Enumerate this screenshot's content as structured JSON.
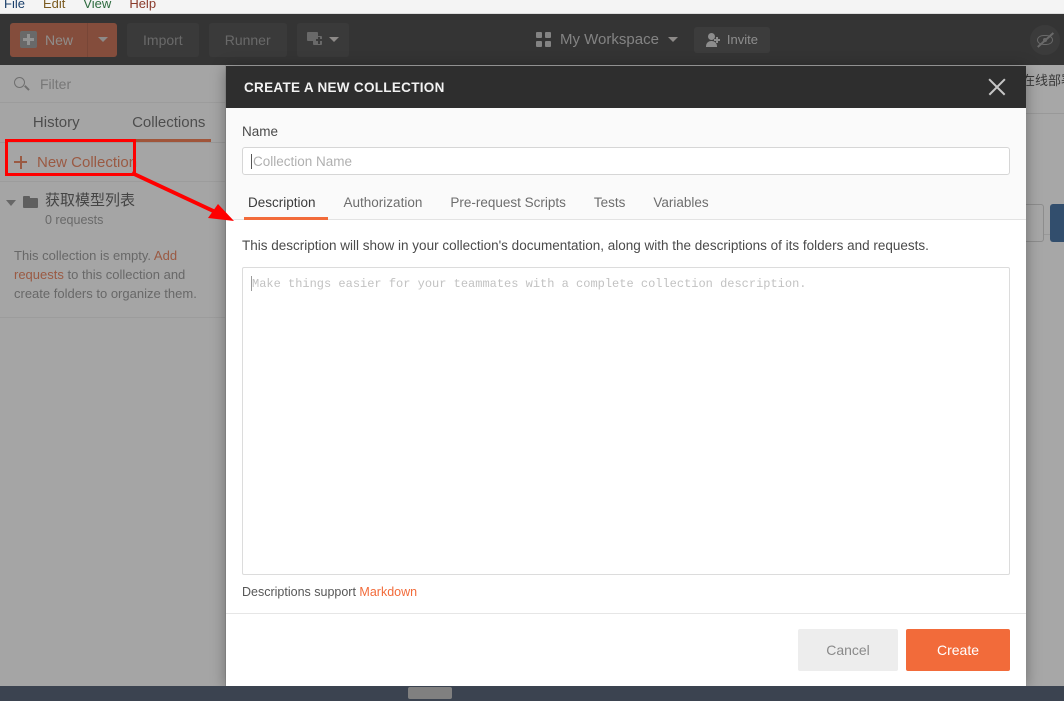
{
  "menubar": {
    "items": [
      "File",
      "Edit",
      "View",
      "Help"
    ]
  },
  "toolbar": {
    "new_label": "New",
    "new_icon": "plus-square-icon",
    "new_caret_icon": "caret-down-icon",
    "import_label": "Import",
    "runner_label": "Runner",
    "new_tab_icon": "new-tab-icon",
    "new_tab_caret_icon": "caret-down-icon"
  },
  "workspace": {
    "grid_icon": "grid-icon",
    "name": "My Workspace",
    "caret_icon": "caret-down-icon",
    "invite_label": "Invite",
    "invite_icon": "person-add-icon",
    "eye_slash_icon": "eye-slash-icon"
  },
  "sidebar": {
    "filter_placeholder": "Filter",
    "search_icon": "search-icon",
    "tabs": [
      {
        "label": "History",
        "active": false
      },
      {
        "label": "Collections",
        "active": true
      }
    ],
    "new_collection_label": "New Collection",
    "new_collection_icon": "plus-icon",
    "collection": {
      "expand_icon": "triangle-down-icon",
      "folder_icon": "folder-icon",
      "name": "获取模型列表",
      "requests": "0 requests"
    },
    "empty_message_prefix": "This collection is empty. ",
    "empty_message_link": "Add requests",
    "empty_message_suffix": " to this collection and create folders to organize them."
  },
  "right_panel": {
    "clipped_title": "在线部署"
  },
  "modal": {
    "title": "CREATE A NEW COLLECTION",
    "close_icon": "close-icon",
    "name_label": "Name",
    "name_value": "",
    "name_placeholder": "Collection Name",
    "tabs": [
      {
        "label": "Description",
        "active": true
      },
      {
        "label": "Authorization",
        "active": false
      },
      {
        "label": "Pre-request Scripts",
        "active": false
      },
      {
        "label": "Tests",
        "active": false
      },
      {
        "label": "Variables",
        "active": false
      }
    ],
    "description_help": "This description will show in your collection's documentation, along with the descriptions of its folders and requests.",
    "description_value": "",
    "description_placeholder": "Make things easier for your teammates with a complete collection description.",
    "markdown_note_prefix": "Descriptions support ",
    "markdown_link": "Markdown",
    "cancel_label": "Cancel",
    "create_label": "Create"
  },
  "annotations": {
    "highlight_target": "New Collection",
    "arrow_target": "Description tab",
    "color": "#ff0000"
  },
  "colors": {
    "accent_orange": "#f26b3a",
    "toolbar_dark": "#2f2f2f",
    "modal_header": "#2e2e2e",
    "blue_button": "#2b5d96",
    "status_bar": "#3b4350"
  }
}
